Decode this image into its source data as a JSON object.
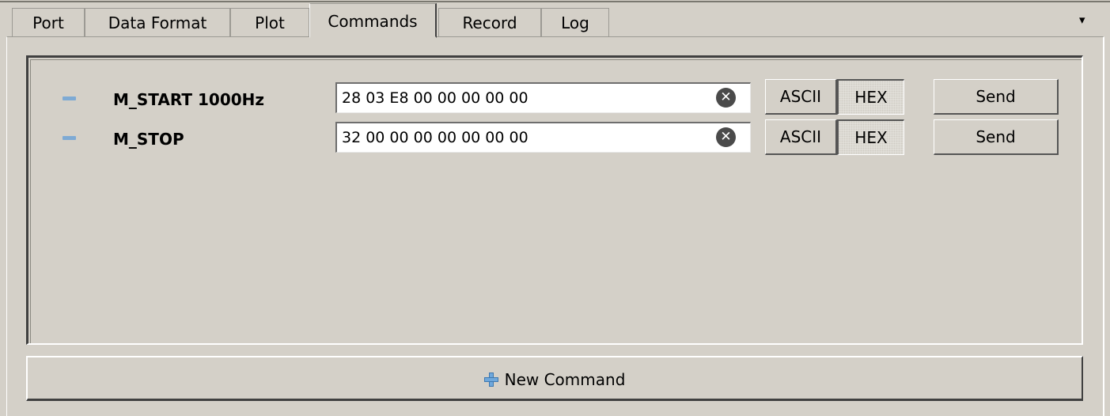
{
  "tabs": [
    {
      "label": "Port",
      "active": false
    },
    {
      "label": "Data Format",
      "active": false
    },
    {
      "label": "Plot",
      "active": false
    },
    {
      "label": "Commands",
      "active": true
    },
    {
      "label": "Record",
      "active": false
    },
    {
      "label": "Log",
      "active": false
    }
  ],
  "menu_arrow": "▾",
  "commands": [
    {
      "name": "M_START 1000Hz",
      "value": "28 03 E8 00 00 00 00 00",
      "format": "HEX",
      "ascii_label": "ASCII",
      "hex_label": "HEX",
      "send_label": "Send"
    },
    {
      "name": "M_STOP",
      "value": "32 00 00 00 00 00 00 00",
      "format": "HEX",
      "ascii_label": "ASCII",
      "hex_label": "HEX",
      "send_label": "Send"
    }
  ],
  "clear_glyph": "✕",
  "new_command_label": "New Command",
  "colors": {
    "background": "#d4d0c8",
    "accent": "#6fa8dc"
  }
}
